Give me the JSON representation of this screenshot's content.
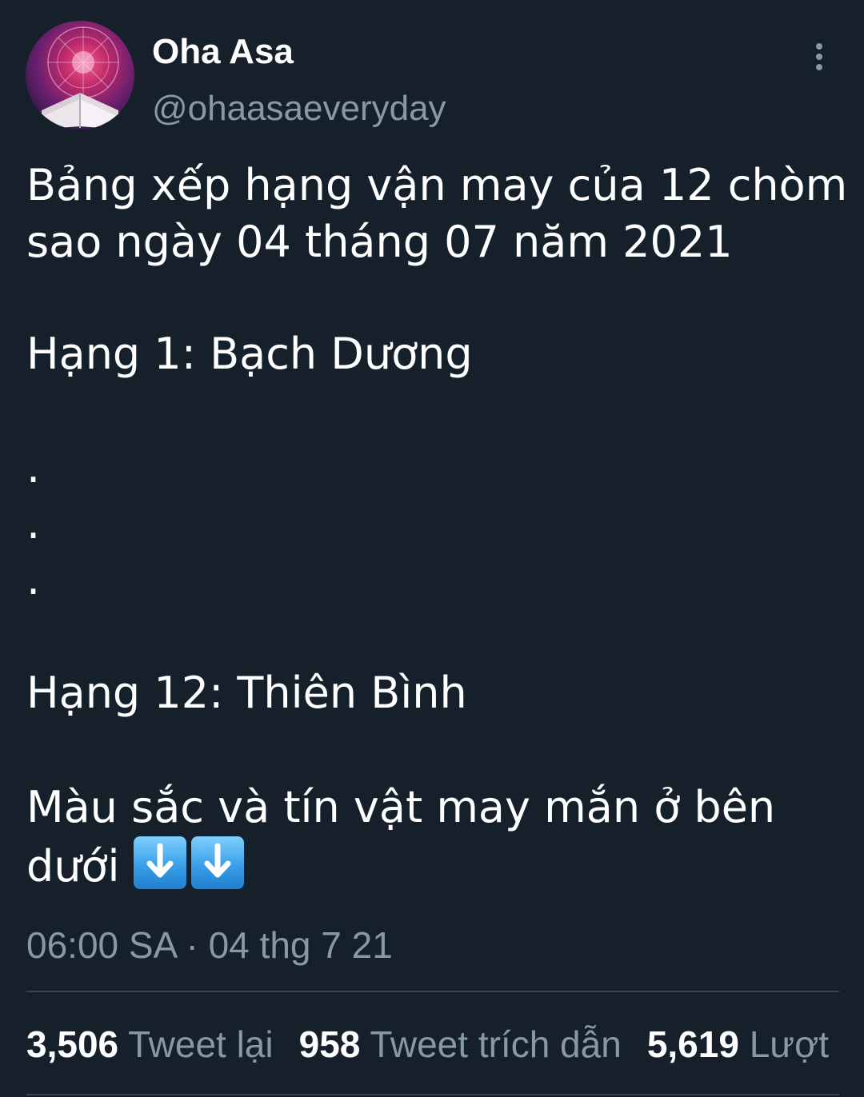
{
  "author": {
    "display_name": "Oha Asa",
    "handle": "@ohaasaeveryday"
  },
  "tweet": {
    "lines": [
      "Bảng xếp hạng vận may của 12 chòm",
      "sao ngày 04 tháng 07 năm 2021",
      "Hạng 1: Bạch Dương",
      ".",
      ".",
      ".",
      "Hạng 12: Thiên Bình",
      "Màu sắc và tín vật may mắn ở bên",
      "dưới"
    ],
    "emoji": [
      "arrow-down-icon",
      "arrow-down-icon"
    ],
    "timestamp": "06:00 SA · 04 thg 7 21"
  },
  "stats": {
    "retweets": {
      "count": "3,506",
      "label": "Tweet lại"
    },
    "quotes": {
      "count": "958",
      "label": "Tweet trích dẫn"
    },
    "likes": {
      "count": "5,619",
      "label": "Lượt"
    }
  },
  "colors": {
    "background": "#15202b",
    "text": "#ffffff",
    "secondary_text": "#8899a6",
    "divider": "#38444d"
  }
}
